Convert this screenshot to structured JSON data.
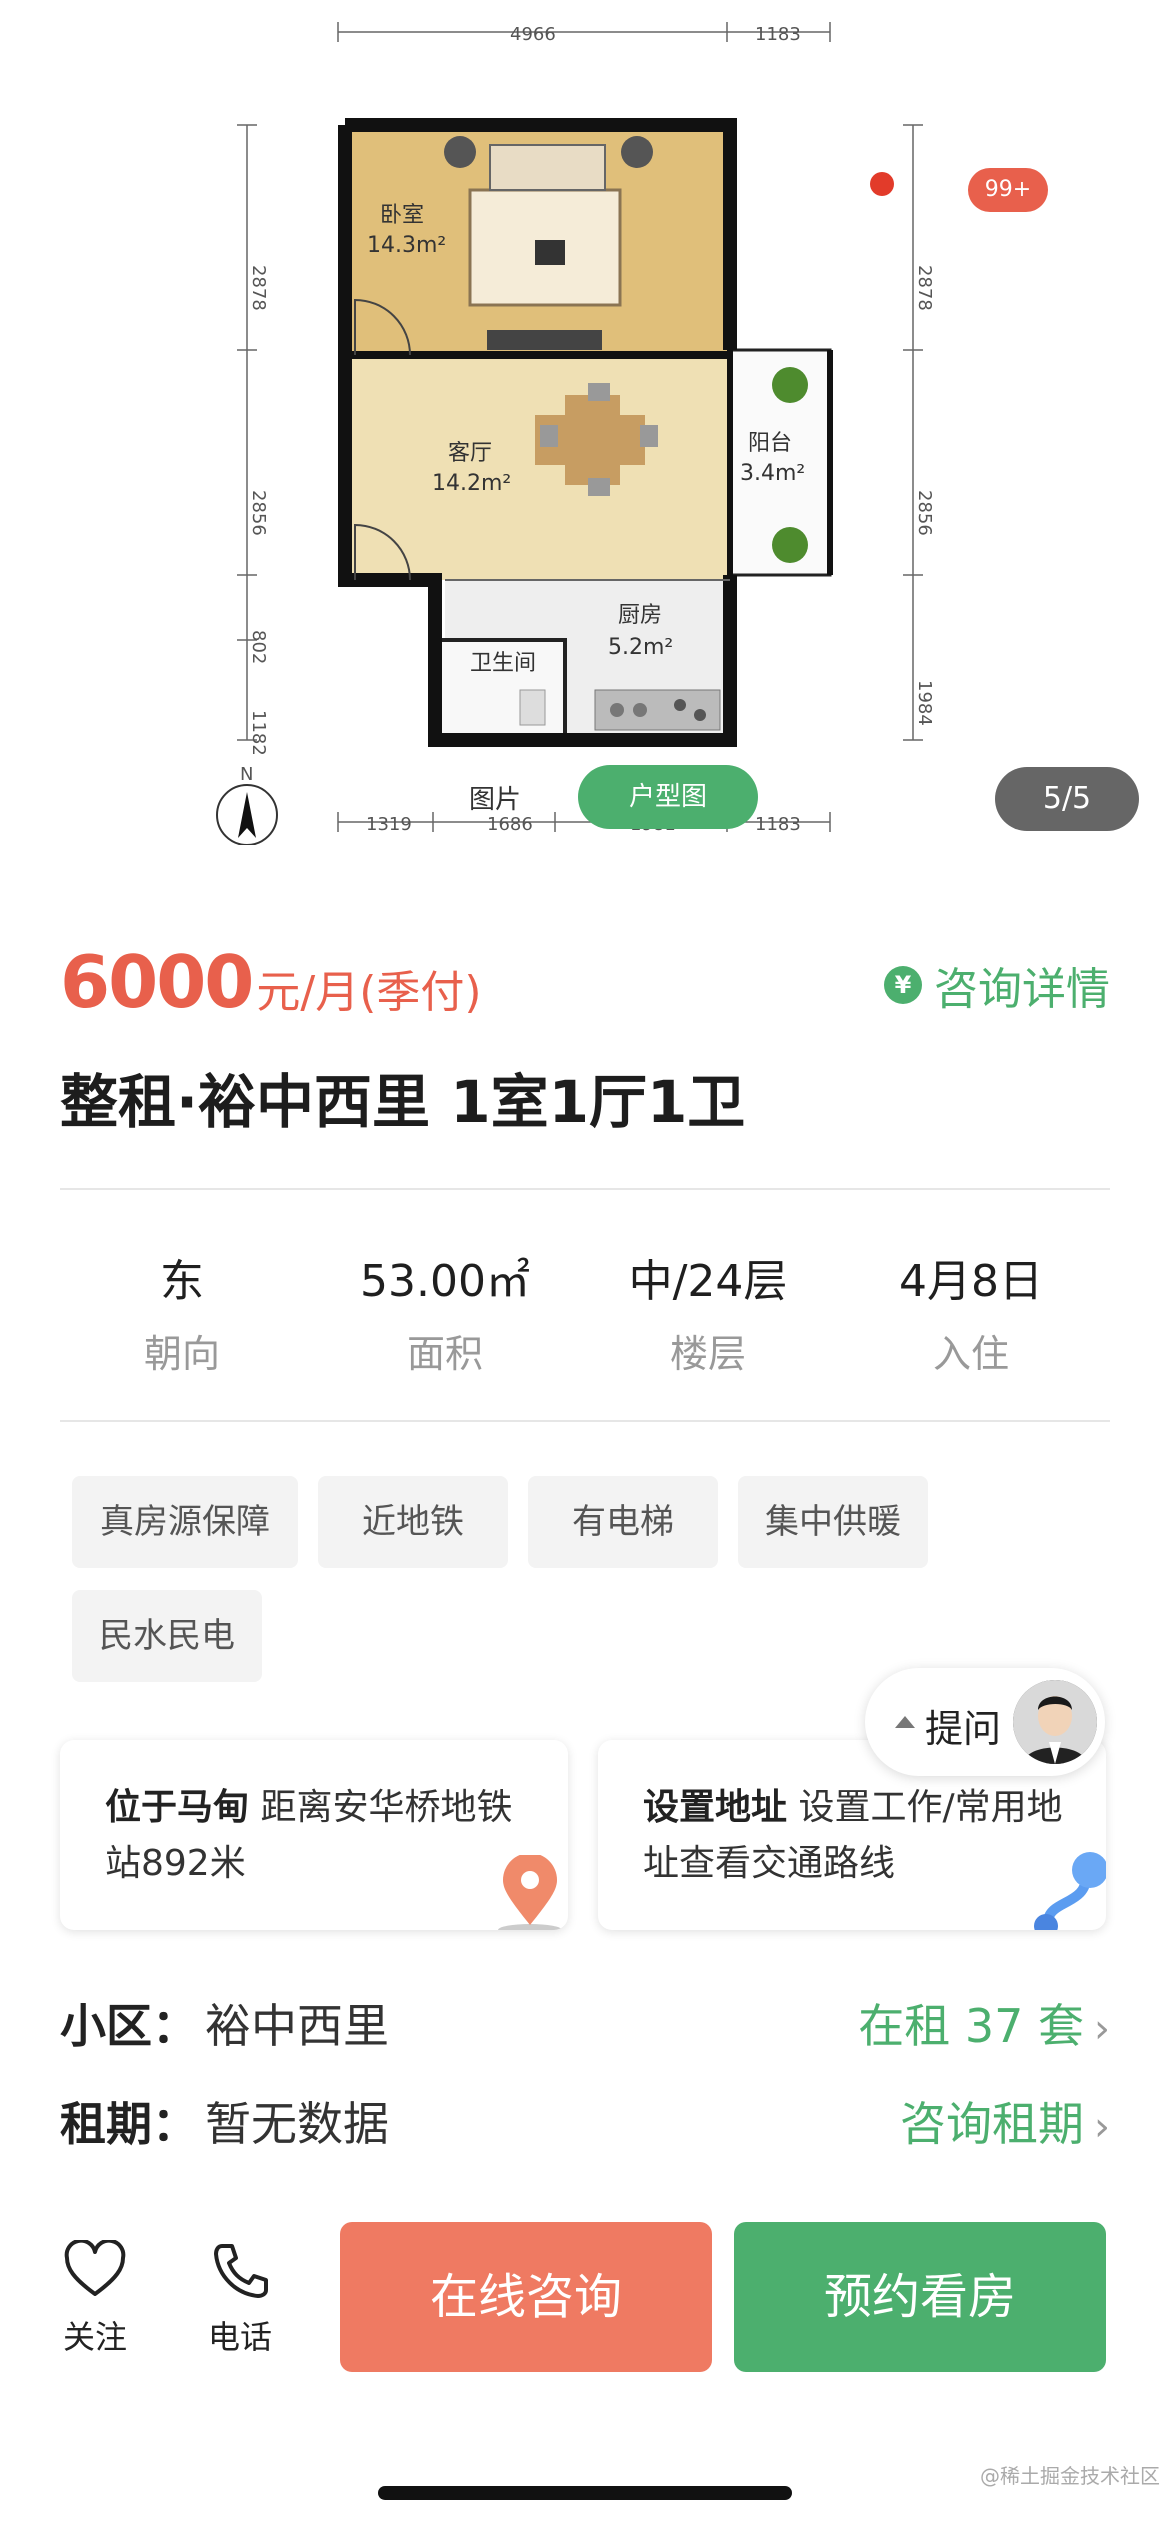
{
  "gallery": {
    "dims_top": [
      "4966",
      "1183"
    ],
    "dims_bottom": [
      "1319",
      "1686",
      "1981",
      "1183"
    ],
    "dims_left": [
      "2878",
      "2856",
      "802",
      "1182"
    ],
    "dims_right": [
      "2878",
      "2856",
      "1984"
    ],
    "north": "N",
    "rooms": [
      {
        "name": "卧室",
        "area": "14.3m²"
      },
      {
        "name": "客厅",
        "area": "14.2m²"
      },
      {
        "name": "阳台",
        "area": "3.4m²"
      },
      {
        "name": "厨房",
        "area": "5.2m²"
      },
      {
        "name": "卫生间",
        "area": ""
      }
    ],
    "tab_photo": "图片",
    "tab_plan": "户型图",
    "counter": "5/5",
    "badge": "99+"
  },
  "listing": {
    "price": "6000",
    "price_unit": "元/月(季付)",
    "consult_icon": "¥",
    "consult_label": "咨询详情",
    "title": "整租·裕中西里 1室1厅1卫"
  },
  "stats": [
    {
      "value": "东",
      "label": "朝向"
    },
    {
      "value": "53.00㎡",
      "label": "面积"
    },
    {
      "value": "中/24层",
      "label": "楼层"
    },
    {
      "value": "4月8日",
      "label": "入住"
    }
  ],
  "tags": [
    "真房源保障",
    "近地铁",
    "有电梯",
    "集中供暖",
    "民水民电"
  ],
  "ask": {
    "label": "提问"
  },
  "cards": {
    "location": {
      "bold": "位于马甸",
      "text": "距离安华桥地铁站892米"
    },
    "address": {
      "bold": "设置地址",
      "text": "设置工作/常用地址查看交通路线"
    }
  },
  "info": {
    "community_key": "小区：",
    "community_val": "裕中西里",
    "community_link": "在租 37 套",
    "lease_key": "租期：",
    "lease_val": "暂无数据",
    "lease_link": "咨询租期"
  },
  "bottom": {
    "follow": "关注",
    "phone": "电话",
    "online": "在线咨询",
    "visit": "预约看房"
  },
  "watermark": "@稀土掘金技术社区",
  "colors": {
    "green": "#4caf6e",
    "red": "#e8604c"
  }
}
